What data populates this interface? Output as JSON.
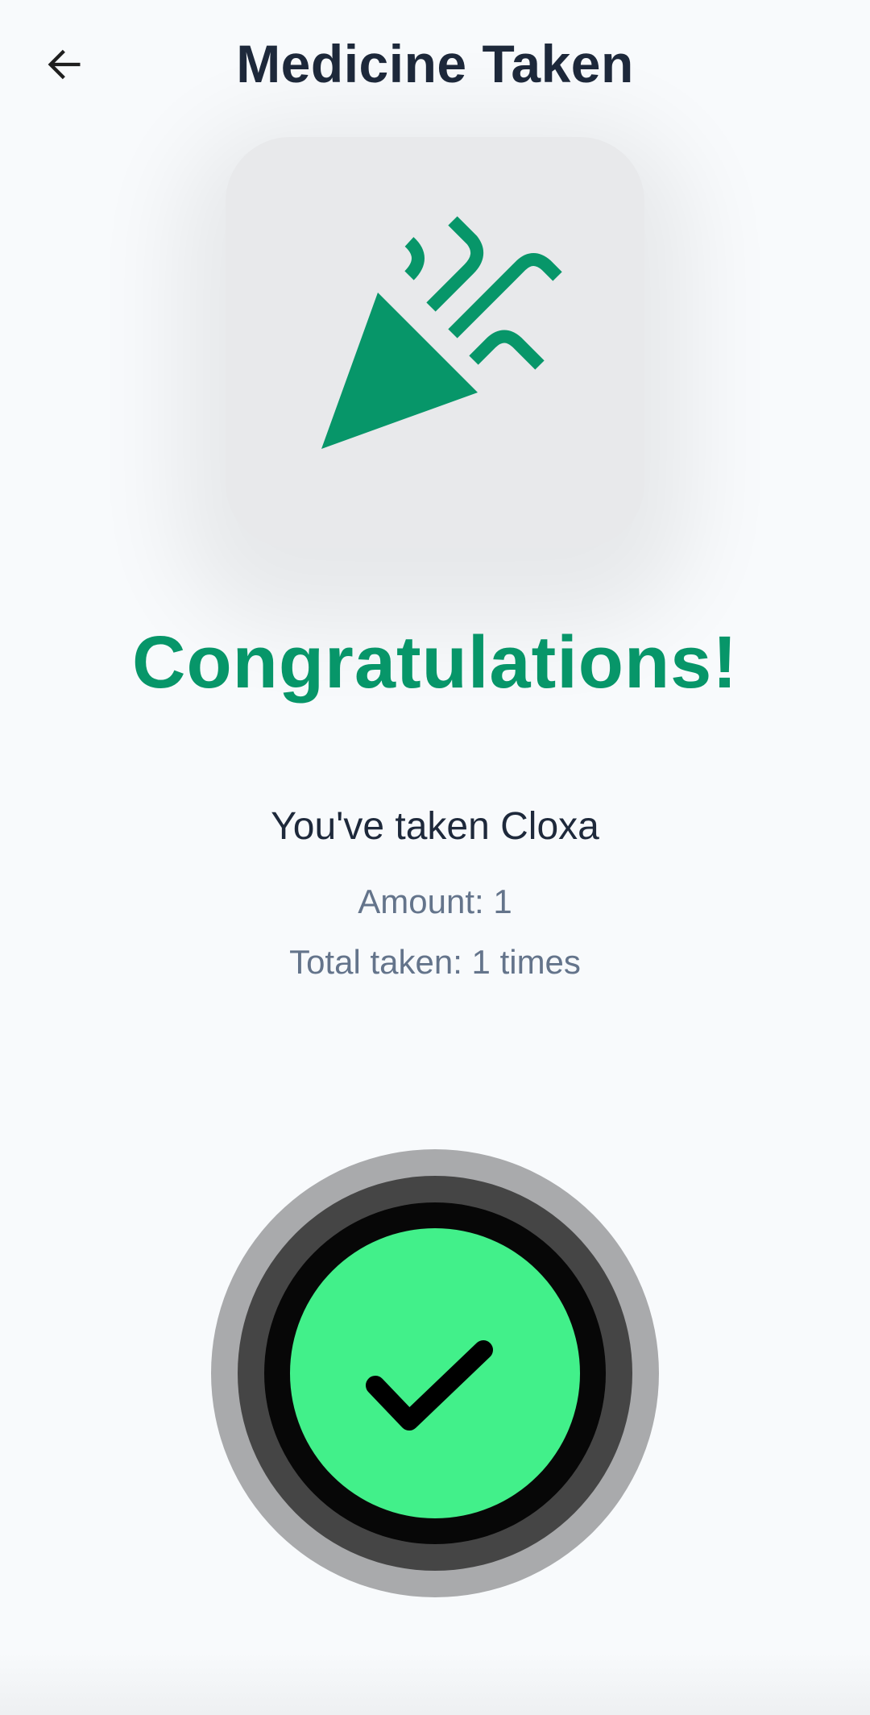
{
  "header": {
    "title": "Medicine Taken",
    "back_icon": "arrow-left-icon"
  },
  "hero": {
    "icon": "party-popper-icon",
    "accent_color": "#079669"
  },
  "main": {
    "congrats": "Congratulations!",
    "taken_message": "You've taken Cloxa",
    "amount": "Amount: 1",
    "total": "Total taken: 1 times"
  },
  "confirm": {
    "icon": "checkmark-icon",
    "button_color": "#42f08a"
  }
}
